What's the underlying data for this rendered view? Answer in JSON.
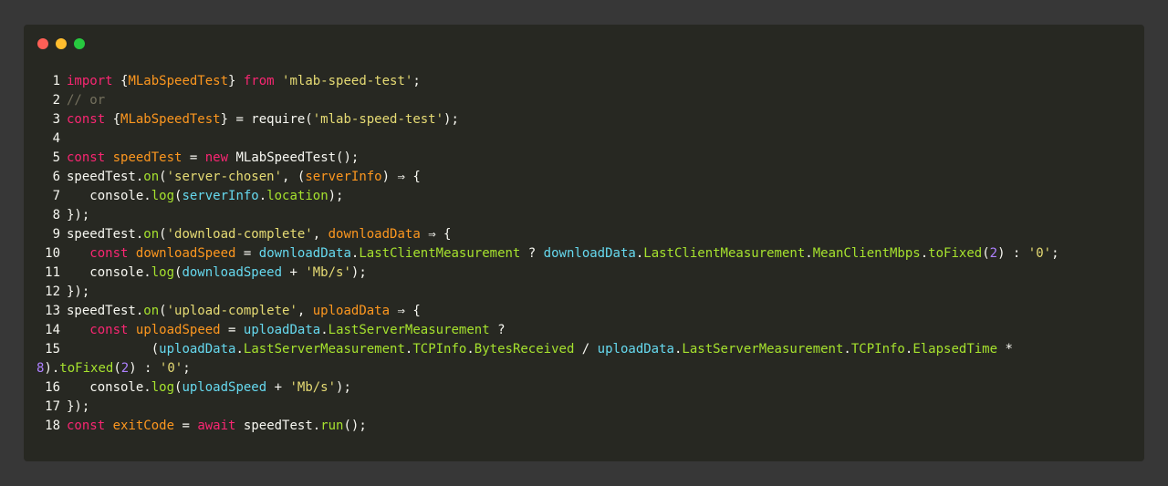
{
  "window": {
    "dots": [
      {
        "name": "close",
        "color": "#ff5f56"
      },
      {
        "name": "minimize",
        "color": "#ffbd2e"
      },
      {
        "name": "maximize",
        "color": "#27c93f"
      }
    ]
  },
  "code": {
    "lines": [
      {
        "n": "1",
        "tokens": [
          [
            "k",
            "import"
          ],
          [
            "x",
            " {"
          ],
          [
            "v",
            "MLabSpeedTest"
          ],
          [
            "x",
            "} "
          ],
          [
            "k",
            "from"
          ],
          [
            "x",
            " "
          ],
          [
            "s",
            "'mlab-speed-test'"
          ],
          [
            "x",
            ";"
          ]
        ]
      },
      {
        "n": "2",
        "tokens": [
          [
            "c",
            "// or"
          ]
        ]
      },
      {
        "n": "3",
        "tokens": [
          [
            "k",
            "const"
          ],
          [
            "x",
            " {"
          ],
          [
            "v",
            "MLabSpeedTest"
          ],
          [
            "x",
            "} = require("
          ],
          [
            "s",
            "'mlab-speed-test'"
          ],
          [
            "x",
            ");"
          ]
        ]
      },
      {
        "n": "4",
        "tokens": []
      },
      {
        "n": "5",
        "tokens": [
          [
            "k",
            "const"
          ],
          [
            "x",
            " "
          ],
          [
            "v",
            "speedTest"
          ],
          [
            "x",
            " = "
          ],
          [
            "k",
            "new"
          ],
          [
            "x",
            " MLabSpeedTest();"
          ]
        ]
      },
      {
        "n": "6",
        "tokens": [
          [
            "x",
            "speedTest."
          ],
          [
            "p",
            "on"
          ],
          [
            "x",
            "("
          ],
          [
            "s",
            "'server-chosen'"
          ],
          [
            "x",
            ", ("
          ],
          [
            "v",
            "serverInfo"
          ],
          [
            "x",
            ") ⇒ {"
          ]
        ]
      },
      {
        "n": "7",
        "tokens": [
          [
            "x",
            "   console."
          ],
          [
            "p",
            "log"
          ],
          [
            "x",
            "("
          ],
          [
            "t",
            "serverInfo"
          ],
          [
            "x",
            "."
          ],
          [
            "p",
            "location"
          ],
          [
            "x",
            ");"
          ]
        ]
      },
      {
        "n": "8",
        "tokens": [
          [
            "x",
            "});"
          ]
        ]
      },
      {
        "n": "9",
        "tokens": [
          [
            "x",
            "speedTest."
          ],
          [
            "p",
            "on"
          ],
          [
            "x",
            "("
          ],
          [
            "s",
            "'download-complete'"
          ],
          [
            "x",
            ", "
          ],
          [
            "v",
            "downloadData"
          ],
          [
            "x",
            " ⇒ {"
          ]
        ]
      },
      {
        "n": "10",
        "tokens": [
          [
            "x",
            "   "
          ],
          [
            "k",
            "const"
          ],
          [
            "x",
            " "
          ],
          [
            "v",
            "downloadSpeed"
          ],
          [
            "x",
            " = "
          ],
          [
            "t",
            "downloadData"
          ],
          [
            "x",
            "."
          ],
          [
            "p",
            "LastClientMeasurement"
          ],
          [
            "x",
            " ? "
          ],
          [
            "t",
            "downloadData"
          ],
          [
            "x",
            "."
          ],
          [
            "p",
            "LastClientMeasurement"
          ],
          [
            "x",
            "."
          ],
          [
            "p",
            "MeanClientMbps"
          ],
          [
            "x",
            "."
          ],
          [
            "p",
            "toFixed"
          ],
          [
            "x",
            "("
          ],
          [
            "n",
            "2"
          ],
          [
            "x",
            ") : "
          ],
          [
            "s",
            "'0'"
          ],
          [
            "x",
            ";"
          ]
        ]
      },
      {
        "n": "11",
        "tokens": [
          [
            "x",
            "   console."
          ],
          [
            "p",
            "log"
          ],
          [
            "x",
            "("
          ],
          [
            "t",
            "downloadSpeed"
          ],
          [
            "x",
            " + "
          ],
          [
            "s",
            "'Mb/s'"
          ],
          [
            "x",
            ");"
          ]
        ]
      },
      {
        "n": "12",
        "tokens": [
          [
            "x",
            "});"
          ]
        ]
      },
      {
        "n": "13",
        "tokens": [
          [
            "x",
            "speedTest."
          ],
          [
            "p",
            "on"
          ],
          [
            "x",
            "("
          ],
          [
            "s",
            "'upload-complete'"
          ],
          [
            "x",
            ", "
          ],
          [
            "v",
            "uploadData"
          ],
          [
            "x",
            " ⇒ {"
          ]
        ]
      },
      {
        "n": "14",
        "tokens": [
          [
            "x",
            "   "
          ],
          [
            "k",
            "const"
          ],
          [
            "x",
            " "
          ],
          [
            "v",
            "uploadSpeed"
          ],
          [
            "x",
            " = "
          ],
          [
            "t",
            "uploadData"
          ],
          [
            "x",
            "."
          ],
          [
            "p",
            "LastServerMeasurement"
          ],
          [
            "x",
            " ?"
          ]
        ]
      },
      {
        "n": "15",
        "tokens": [
          [
            "x",
            "           ("
          ],
          [
            "t",
            "uploadData"
          ],
          [
            "x",
            "."
          ],
          [
            "p",
            "LastServerMeasurement"
          ],
          [
            "x",
            "."
          ],
          [
            "p",
            "TCPInfo"
          ],
          [
            "x",
            "."
          ],
          [
            "p",
            "BytesReceived"
          ],
          [
            "x",
            " / "
          ],
          [
            "t",
            "uploadData"
          ],
          [
            "x",
            "."
          ],
          [
            "p",
            "LastServerMeasurement"
          ],
          [
            "x",
            "."
          ],
          [
            "p",
            "TCPInfo"
          ],
          [
            "x",
            "."
          ],
          [
            "p",
            "ElapsedTime"
          ],
          [
            "x",
            " *"
          ]
        ]
      },
      {
        "n": "",
        "tokens": [
          [
            "n",
            "8"
          ],
          [
            "x",
            ")."
          ],
          [
            "p",
            "toFixed"
          ],
          [
            "x",
            "("
          ],
          [
            "n",
            "2"
          ],
          [
            "x",
            ") : "
          ],
          [
            "s",
            "'0'"
          ],
          [
            "x",
            ";"
          ]
        ]
      },
      {
        "n": "16",
        "tokens": [
          [
            "x",
            "   console."
          ],
          [
            "p",
            "log"
          ],
          [
            "x",
            "("
          ],
          [
            "t",
            "uploadSpeed"
          ],
          [
            "x",
            " + "
          ],
          [
            "s",
            "'Mb/s'"
          ],
          [
            "x",
            ");"
          ]
        ]
      },
      {
        "n": "17",
        "tokens": [
          [
            "x",
            "});"
          ]
        ]
      },
      {
        "n": "18",
        "tokens": [
          [
            "k",
            "const"
          ],
          [
            "x",
            " "
          ],
          [
            "v",
            "exitCode"
          ],
          [
            "x",
            " = "
          ],
          [
            "k",
            "await"
          ],
          [
            "x",
            " speedTest."
          ],
          [
            "p",
            "run"
          ],
          [
            "x",
            "();"
          ]
        ]
      }
    ]
  }
}
